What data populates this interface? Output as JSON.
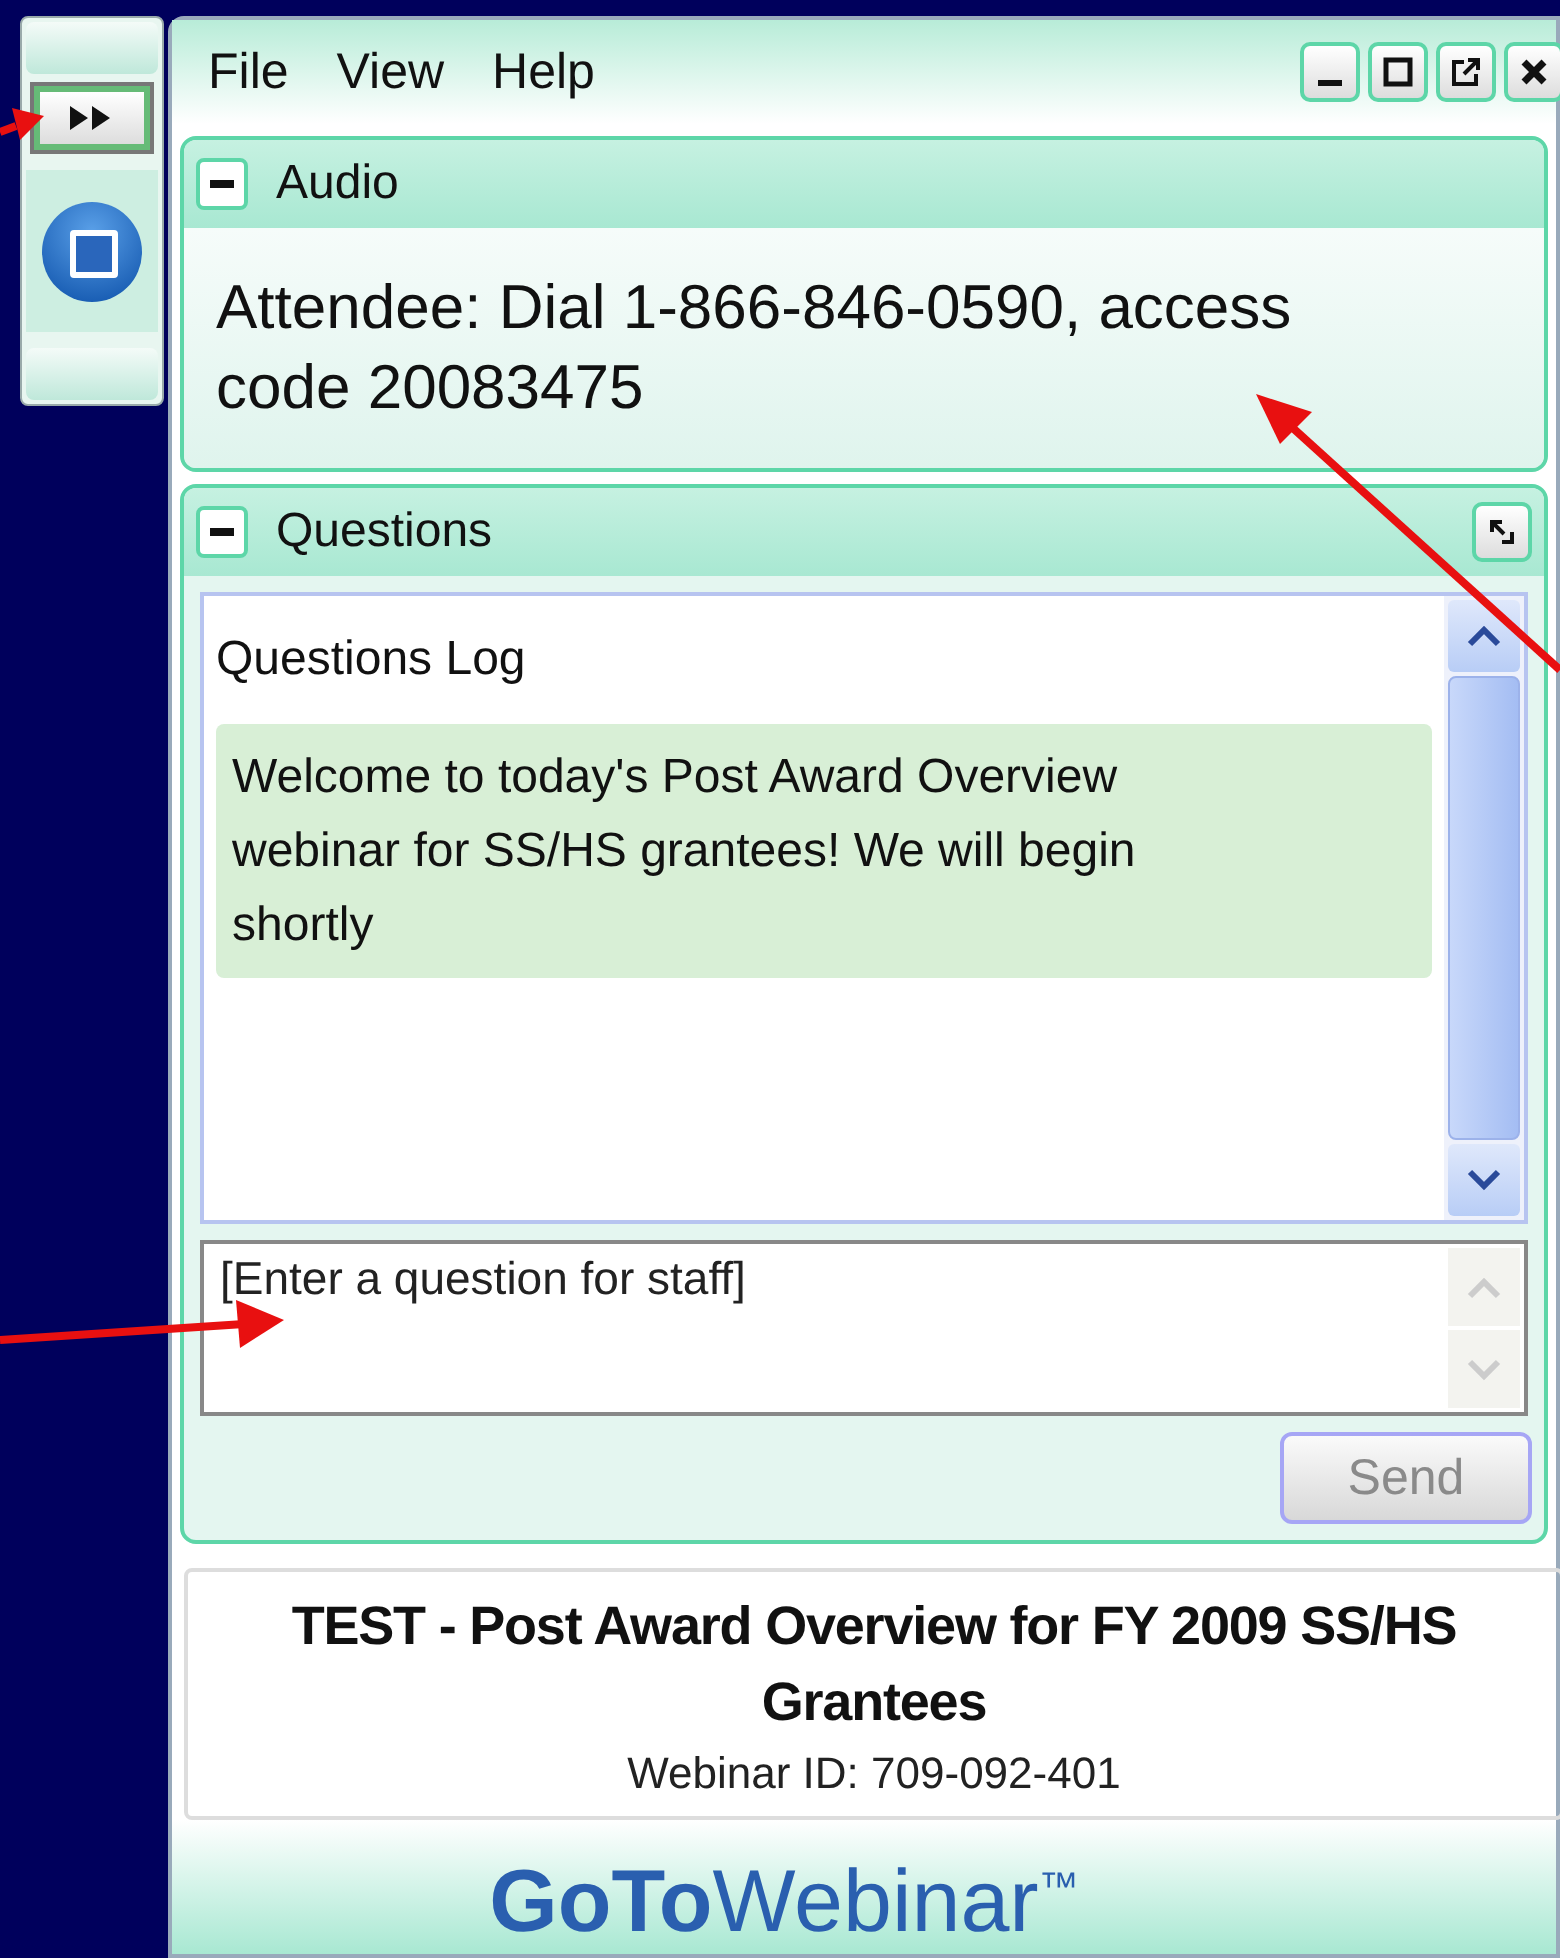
{
  "menu": [
    "File",
    "View",
    "Help"
  ],
  "audio": {
    "title": "Audio",
    "text": "Attendee: Dial 1-866-846-0590, access code 20083475"
  },
  "questions": {
    "title": "Questions",
    "log_title": "Questions Log",
    "messages": [
      "Welcome to today's Post Award Overview webinar for SS/HS grantees! We will begin shortly"
    ],
    "input": {
      "placeholder": "[Enter a question for staff]"
    },
    "send": {
      "label": "Send",
      "disabled": true
    }
  },
  "webinar": {
    "title": "TEST - Post Award Overview for FY 2009 SS/HS Grantees",
    "id": "Webinar ID: 709-092-401"
  },
  "logo": "**GoTo**Webinar$^{™}$"
}
